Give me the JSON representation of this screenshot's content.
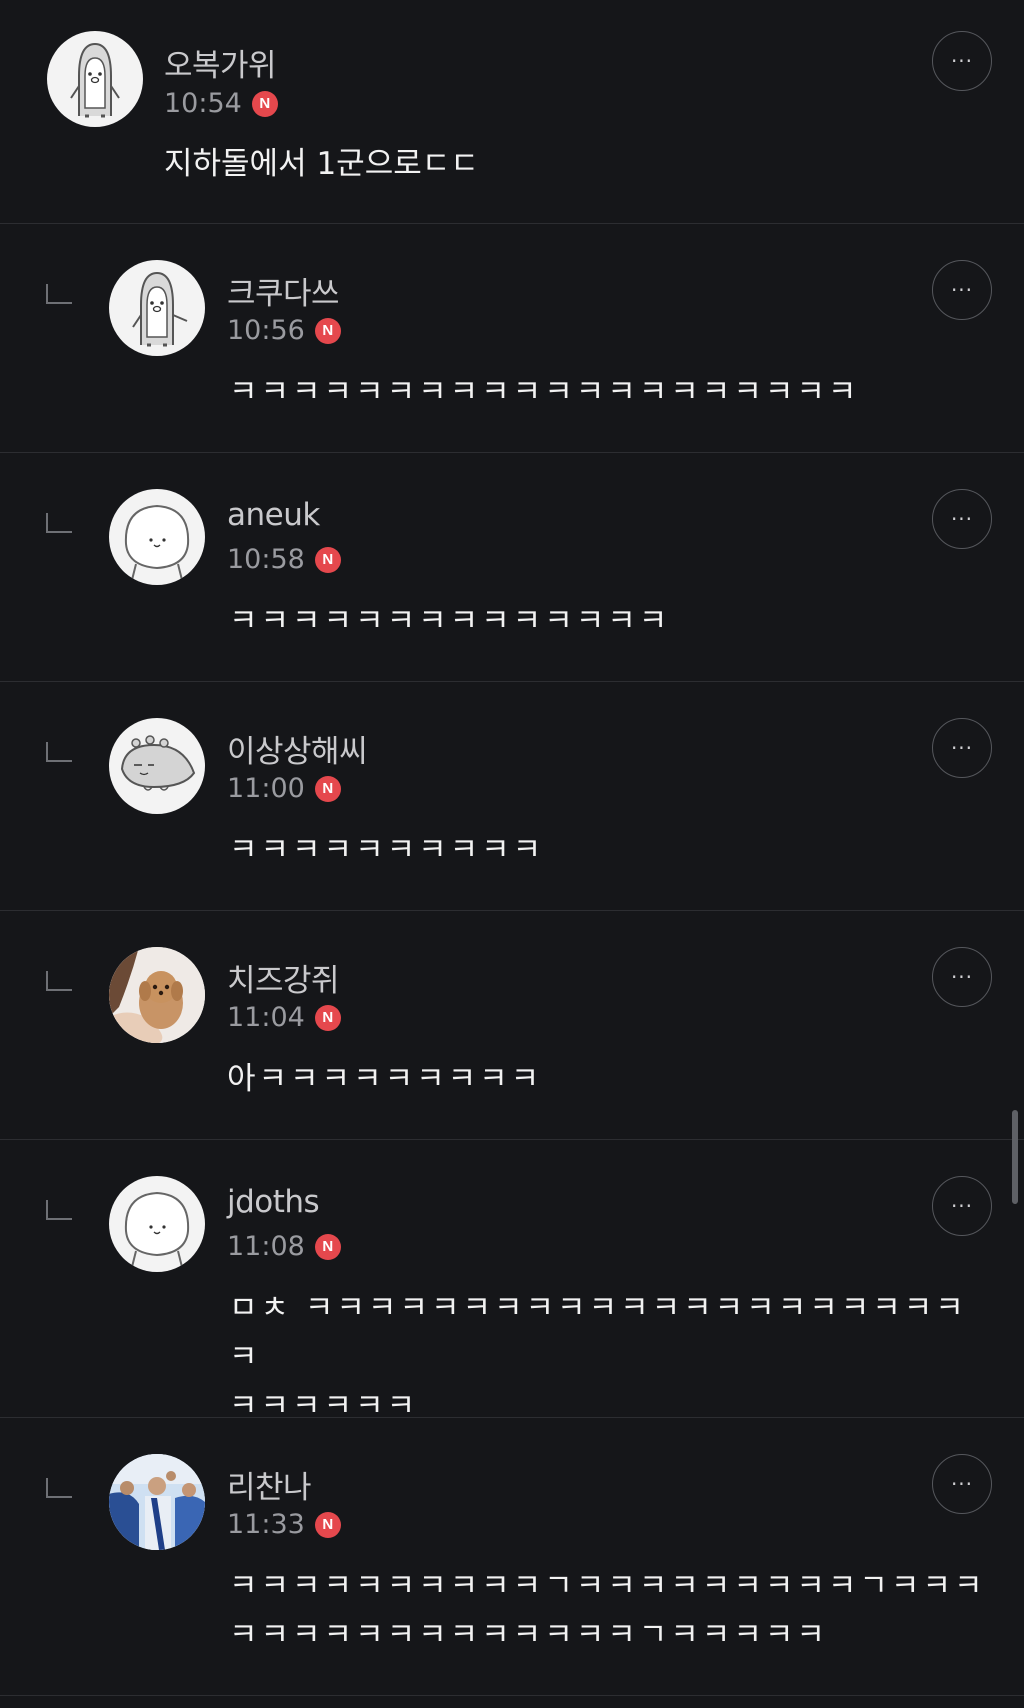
{
  "comments": [
    {
      "author": "오복가위",
      "time": "10:54",
      "badge": "N",
      "text": "지하돌에서 1군으로ㄷㄷ",
      "is_reply": false,
      "avatar_icon": "penguin-character-icon",
      "more_icon": "more-options-icon",
      "more_label": "···"
    },
    {
      "author": "크쿠다쓰",
      "time": "10:56",
      "badge": "N",
      "text": "ㅋㅋㅋㅋㅋㅋㅋㅋㅋㅋㅋㅋㅋㅋㅋㅋㅋㅋㅋㅋ",
      "is_reply": true,
      "avatar_icon": "penguin-character-icon",
      "more_icon": "more-options-icon",
      "more_label": "···"
    },
    {
      "author": "aneuk",
      "time": "10:58",
      "badge": "N",
      "text": "ㅋㅋㅋㅋㅋㅋㅋㅋㅋㅋㅋㅋㅋㅋ",
      "is_reply": true,
      "avatar_icon": "round-character-icon",
      "more_icon": "more-options-icon",
      "more_label": "···"
    },
    {
      "author": "이상상해씨",
      "time": "11:00",
      "badge": "N",
      "text": "ㅋㅋㅋㅋㅋㅋㅋㅋㅋㅋ",
      "is_reply": true,
      "avatar_icon": "dinosaur-character-icon",
      "more_icon": "more-options-icon",
      "more_label": "···"
    },
    {
      "author": "치즈강쥐",
      "time": "11:04",
      "badge": "N",
      "text": "아ㅋㅋㅋㅋㅋㅋㅋㅋㅋ",
      "is_reply": true,
      "avatar_icon": "puppy-photo-icon",
      "more_icon": "more-options-icon",
      "more_label": "···"
    },
    {
      "author": "jdoths",
      "time": "11:08",
      "badge": "N",
      "text": "ㅁㅊ ㅋㅋㅋㅋㅋㅋㅋㅋㅋㅋㅋㅋㅋㅋㅋㅋㅋㅋㅋㅋㅋㅋ\nㅋㅋㅋㅋㅋㅋ",
      "is_reply": true,
      "avatar_icon": "round-character-icon",
      "more_icon": "more-options-icon",
      "more_label": "···"
    },
    {
      "author": "리찬나",
      "time": "11:33",
      "badge": "N",
      "text": "ㅋㅋㅋㅋㅋㅋㅋㅋㅋㅋㄱㅋㅋㅋㅋㅋㅋㅋㅋㅋㄱㅋㅋㅋ\nㅋㅋㅋㅋㅋㅋㅋㅋㅋㅋㅋㅋㅋㄱㅋㅋㅋㅋㅋ",
      "is_reply": true,
      "avatar_icon": "crowd-photo-icon",
      "more_icon": "more-options-icon",
      "more_label": "···"
    }
  ],
  "colors": {
    "background": "#151619",
    "badge": "#e5484d",
    "divider": "#2c2d31"
  }
}
